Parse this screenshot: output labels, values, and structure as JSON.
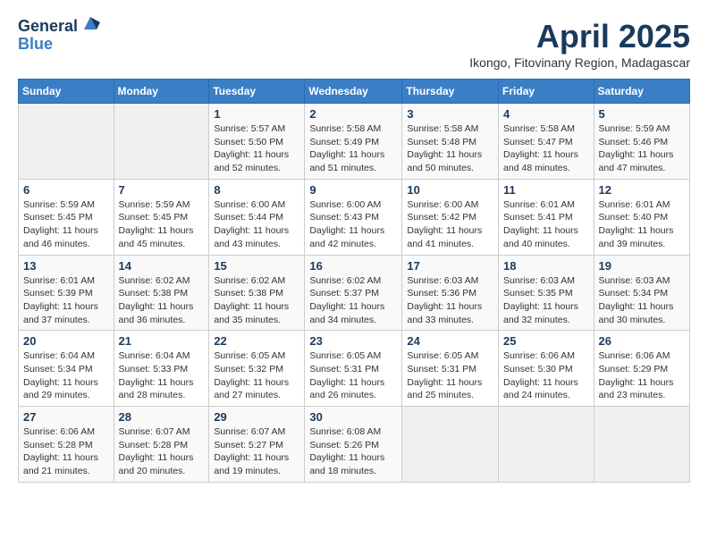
{
  "header": {
    "logo_general": "General",
    "logo_blue": "Blue",
    "month_title": "April 2025",
    "subtitle": "Ikongo, Fitovinany Region, Madagascar"
  },
  "days_of_week": [
    "Sunday",
    "Monday",
    "Tuesday",
    "Wednesday",
    "Thursday",
    "Friday",
    "Saturday"
  ],
  "weeks": [
    [
      {
        "day": "",
        "empty": true
      },
      {
        "day": "",
        "empty": true
      },
      {
        "day": "1",
        "sunrise": "5:57 AM",
        "sunset": "5:50 PM",
        "daylight": "11 hours and 52 minutes."
      },
      {
        "day": "2",
        "sunrise": "5:58 AM",
        "sunset": "5:49 PM",
        "daylight": "11 hours and 51 minutes."
      },
      {
        "day": "3",
        "sunrise": "5:58 AM",
        "sunset": "5:48 PM",
        "daylight": "11 hours and 50 minutes."
      },
      {
        "day": "4",
        "sunrise": "5:58 AM",
        "sunset": "5:47 PM",
        "daylight": "11 hours and 48 minutes."
      },
      {
        "day": "5",
        "sunrise": "5:59 AM",
        "sunset": "5:46 PM",
        "daylight": "11 hours and 47 minutes."
      }
    ],
    [
      {
        "day": "6",
        "sunrise": "5:59 AM",
        "sunset": "5:45 PM",
        "daylight": "11 hours and 46 minutes."
      },
      {
        "day": "7",
        "sunrise": "5:59 AM",
        "sunset": "5:45 PM",
        "daylight": "11 hours and 45 minutes."
      },
      {
        "day": "8",
        "sunrise": "6:00 AM",
        "sunset": "5:44 PM",
        "daylight": "11 hours and 43 minutes."
      },
      {
        "day": "9",
        "sunrise": "6:00 AM",
        "sunset": "5:43 PM",
        "daylight": "11 hours and 42 minutes."
      },
      {
        "day": "10",
        "sunrise": "6:00 AM",
        "sunset": "5:42 PM",
        "daylight": "11 hours and 41 minutes."
      },
      {
        "day": "11",
        "sunrise": "6:01 AM",
        "sunset": "5:41 PM",
        "daylight": "11 hours and 40 minutes."
      },
      {
        "day": "12",
        "sunrise": "6:01 AM",
        "sunset": "5:40 PM",
        "daylight": "11 hours and 39 minutes."
      }
    ],
    [
      {
        "day": "13",
        "sunrise": "6:01 AM",
        "sunset": "5:39 PM",
        "daylight": "11 hours and 37 minutes."
      },
      {
        "day": "14",
        "sunrise": "6:02 AM",
        "sunset": "5:38 PM",
        "daylight": "11 hours and 36 minutes."
      },
      {
        "day": "15",
        "sunrise": "6:02 AM",
        "sunset": "5:38 PM",
        "daylight": "11 hours and 35 minutes."
      },
      {
        "day": "16",
        "sunrise": "6:02 AM",
        "sunset": "5:37 PM",
        "daylight": "11 hours and 34 minutes."
      },
      {
        "day": "17",
        "sunrise": "6:03 AM",
        "sunset": "5:36 PM",
        "daylight": "11 hours and 33 minutes."
      },
      {
        "day": "18",
        "sunrise": "6:03 AM",
        "sunset": "5:35 PM",
        "daylight": "11 hours and 32 minutes."
      },
      {
        "day": "19",
        "sunrise": "6:03 AM",
        "sunset": "5:34 PM",
        "daylight": "11 hours and 30 minutes."
      }
    ],
    [
      {
        "day": "20",
        "sunrise": "6:04 AM",
        "sunset": "5:34 PM",
        "daylight": "11 hours and 29 minutes."
      },
      {
        "day": "21",
        "sunrise": "6:04 AM",
        "sunset": "5:33 PM",
        "daylight": "11 hours and 28 minutes."
      },
      {
        "day": "22",
        "sunrise": "6:05 AM",
        "sunset": "5:32 PM",
        "daylight": "11 hours and 27 minutes."
      },
      {
        "day": "23",
        "sunrise": "6:05 AM",
        "sunset": "5:31 PM",
        "daylight": "11 hours and 26 minutes."
      },
      {
        "day": "24",
        "sunrise": "6:05 AM",
        "sunset": "5:31 PM",
        "daylight": "11 hours and 25 minutes."
      },
      {
        "day": "25",
        "sunrise": "6:06 AM",
        "sunset": "5:30 PM",
        "daylight": "11 hours and 24 minutes."
      },
      {
        "day": "26",
        "sunrise": "6:06 AM",
        "sunset": "5:29 PM",
        "daylight": "11 hours and 23 minutes."
      }
    ],
    [
      {
        "day": "27",
        "sunrise": "6:06 AM",
        "sunset": "5:28 PM",
        "daylight": "11 hours and 21 minutes."
      },
      {
        "day": "28",
        "sunrise": "6:07 AM",
        "sunset": "5:28 PM",
        "daylight": "11 hours and 20 minutes."
      },
      {
        "day": "29",
        "sunrise": "6:07 AM",
        "sunset": "5:27 PM",
        "daylight": "11 hours and 19 minutes."
      },
      {
        "day": "30",
        "sunrise": "6:08 AM",
        "sunset": "5:26 PM",
        "daylight": "11 hours and 18 minutes."
      },
      {
        "day": "",
        "empty": true
      },
      {
        "day": "",
        "empty": true
      },
      {
        "day": "",
        "empty": true
      }
    ]
  ],
  "labels": {
    "sunrise": "Sunrise: ",
    "sunset": "Sunset: ",
    "daylight": "Daylight: "
  }
}
